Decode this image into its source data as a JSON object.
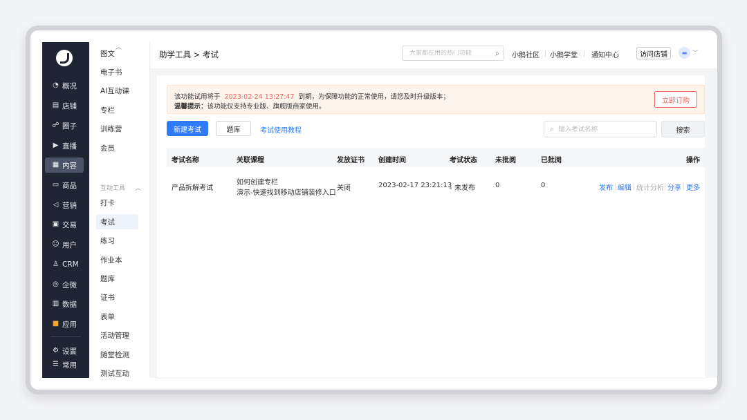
{
  "sidebar": {
    "items": [
      {
        "label": "概况",
        "icon": "pie-chart-icon",
        "glyph": "◔"
      },
      {
        "label": "店铺",
        "icon": "store-icon",
        "glyph": "▤"
      },
      {
        "label": "圈子",
        "icon": "community-icon",
        "glyph": "☍"
      },
      {
        "label": "直播",
        "icon": "live-icon",
        "glyph": "▶"
      },
      {
        "label": "内容",
        "icon": "content-icon",
        "glyph": "▦"
      },
      {
        "label": "商品",
        "icon": "goods-icon",
        "glyph": "▭"
      },
      {
        "label": "营销",
        "icon": "marketing-icon",
        "glyph": "◁"
      },
      {
        "label": "交易",
        "icon": "trade-icon",
        "glyph": "▣"
      },
      {
        "label": "用户",
        "icon": "user-icon",
        "glyph": "☺"
      },
      {
        "label": "CRM",
        "icon": "crm-icon",
        "glyph": "♙"
      },
      {
        "label": "企微",
        "icon": "wecom-icon",
        "glyph": "◎"
      },
      {
        "label": "数据",
        "icon": "data-icon",
        "glyph": "▥"
      },
      {
        "label": "应用",
        "icon": "apps-icon",
        "glyph": "■"
      },
      {
        "label": "设置",
        "icon": "settings-icon",
        "glyph": "⚙"
      },
      {
        "label": "常用",
        "icon": "frequent-icon",
        "glyph": "☰"
      }
    ],
    "active_label": "内容"
  },
  "submenu": {
    "items_top": [
      "图文",
      "电子书",
      "AI互动课",
      "专栏",
      "训练营",
      "会员"
    ],
    "group_title": "互动工具",
    "items_bottom": [
      "打卡",
      "考试",
      "练习",
      "作业本",
      "题库",
      "证书",
      "表单",
      "活动管理",
      "随堂检测",
      "测试互动"
    ],
    "active_label": "考试"
  },
  "header": {
    "breadcrumb": "助学工具 > 考试",
    "search_placeholder": "大家都在用的热门功能",
    "links": [
      "小鹅社区",
      "小鹅学堂",
      "通知中心"
    ],
    "visit_store": "访问店铺"
  },
  "notice": {
    "prefix": "该功能试用将于",
    "date": "2023-02-24 13:27:47",
    "suffix": "到期，为保障功能的正常使用，请您及时升级版本；",
    "tip_label": "温馨提示：",
    "tip_text": "该功能仅支持专业版、旗舰版商家使用。",
    "subscribe": "立即订购"
  },
  "toolbar": {
    "new_exam": "新建考试",
    "question_bank": "题库",
    "tutorial": "考试使用教程",
    "search_placeholder": "输入考试名称",
    "search_button": "搜索"
  },
  "table": {
    "headers": {
      "name": "考试名称",
      "course": "关联课程",
      "certificate": "发放证书",
      "created": "创建时间",
      "status": "考试状态",
      "unmarked": "未批阅",
      "marked": "已批阅",
      "actions": "操作"
    },
    "rows": [
      {
        "name": "产品拆解考试",
        "course_line1": "如何创建专栏",
        "course_line2": "演示-快速找到移动店铺装修入口",
        "certificate": "关闭",
        "created": "2023-02-17 23:21:13",
        "status": "未发布",
        "unmarked": "0",
        "marked": "0",
        "actions": [
          "发布",
          "编辑",
          "统计分析",
          "分享",
          "更多"
        ]
      }
    ]
  },
  "colors": {
    "sidebar_bg": "#1f2532",
    "primary": "#2f7bf5",
    "warning": "#f0655c",
    "notice_bg": "#fff4ec"
  }
}
